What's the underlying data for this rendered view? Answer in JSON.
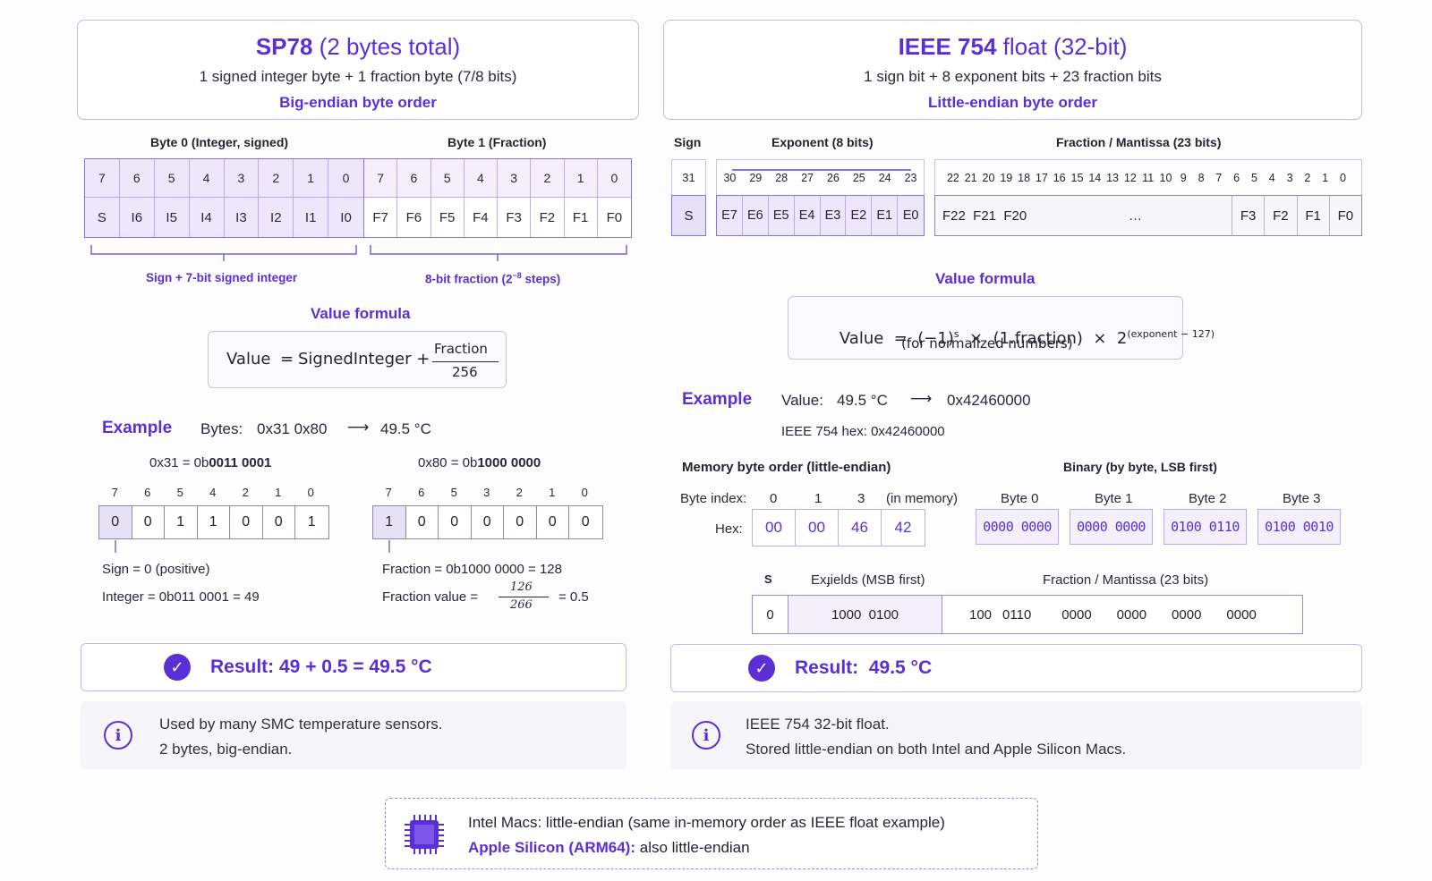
{
  "sp78": {
    "title_bold": "SP78",
    "title_rest": "(2 bytes total)",
    "subtitle": "1 signed integer byte + 1 fraction byte (7/8 bits)",
    "order": "Big-endian byte order",
    "byte0_label": "Byte 0 (Integer, signed)",
    "byte1_label": "Byte 1 (Fraction)",
    "bit_numbers_0": [
      "7",
      "6",
      "5",
      "4",
      "3",
      "2",
      "1",
      "0"
    ],
    "bit_numbers_1": [
      "7",
      "6",
      "5",
      "4",
      "3",
      "2",
      "1",
      "0"
    ],
    "bits_0": [
      "S",
      "I6",
      "I5",
      "I4",
      "I3",
      "I2",
      "I1",
      "I0"
    ],
    "bits_1": [
      "F7",
      "F6",
      "F5",
      "F4",
      "F3",
      "F2",
      "F1",
      "F0"
    ],
    "bracket_0": "Sign + 7-bit signed integer",
    "bracket_1": "8-bit fraction (2",
    "bracket_1_sup": "−8",
    "bracket_1_end": " steps)",
    "formula_title": "Value formula",
    "formula_lhs": "Value",
    "formula_eq": "=",
    "formula_term": "SignedInteger +",
    "formula_num": "Fraction",
    "formula_den": "256",
    "example_title": "Example",
    "example_bytes_label": "Bytes:",
    "example_bytes": "0x31 0x80",
    "example_arrow": "⟶",
    "example_value": "49.5 °C",
    "hex0_label": "0x31 = 0b",
    "hex0_bin": "0011 0001",
    "hex1_label": "0x80 = 0b",
    "hex1_bin": "1000 0000",
    "bits0_nums": [
      "7",
      "6",
      "5",
      "4",
      "2",
      "1",
      "0"
    ],
    "bits0_vals": [
      "0",
      "0",
      "1",
      "1",
      "0",
      "0",
      "1"
    ],
    "bits1_nums": [
      "7",
      "6",
      "5",
      "3",
      "2",
      "1",
      "0"
    ],
    "bits1_vals": [
      "1",
      "0",
      "0",
      "0",
      "0",
      "0",
      "0"
    ],
    "sign_text": "Sign = 0 (positive)",
    "integer_text": "Integer = 0b011 0001 = 49",
    "fraction_text": "Fraction = 0b1000 0000 = 128",
    "fraction_value_label": "Fraction value =",
    "fraction_value_num": "126",
    "fraction_value_den": "266",
    "fraction_value_result": "= 0.5",
    "result": "Result: 49 + 0.5 = 49.5 °C",
    "info_1": "Used by many SMC temperature sensors.",
    "info_2": "2 bytes, big-endian."
  },
  "ieee": {
    "title_bold": "IEEE 754",
    "title_rest": "float (32-bit)",
    "subtitle": "1 sign bit + 8 exponent bits + 23 fraction bits",
    "order": "Little-endian byte order",
    "sign_label": "Sign",
    "exp_label": "Exponent (8 bits)",
    "frac_label": "Fraction / Mantissa (23 bits)",
    "sign_num": "31",
    "exp_nums": [
      "30",
      "29",
      "28",
      "27",
      "26",
      "25",
      "24",
      "23"
    ],
    "frac_nums": [
      "22",
      "21",
      "20",
      "19",
      "18",
      "17",
      "16",
      "15",
      "14",
      "13",
      "12",
      "11",
      "10",
      "9",
      "8",
      "7",
      "6",
      "5",
      "4",
      "3",
      "2",
      "1",
      "0"
    ],
    "sign_bit": "S",
    "exp_bits": [
      "E7",
      "E6",
      "E5",
      "E4",
      "E3",
      "E2",
      "E1",
      "E0"
    ],
    "frac_bits_left": "F22  F21  F20",
    "frac_ellipsis": "…",
    "frac_bits_right": [
      "F3",
      "F2",
      "F1",
      "F0"
    ],
    "formula_title": "Value formula",
    "formula_main": "Value  =  (−1)",
    "formula_s": "s",
    "formula_mid": "  ×  (1.fraction)  ×  2",
    "formula_exp": "(exponent − 127)",
    "formula_note": "(for normalized numbers)",
    "example_title": "Example",
    "example_value_label": "Value:",
    "example_value": "49.5 °C",
    "example_arrow": "⟶",
    "example_hex": "0x42460000",
    "hex_line": "IEEE 754 hex: 0x42460000",
    "mem_title": "Memory byte order (little-endian)",
    "bin_title": "Binary (by byte, LSB first)",
    "byte_index_label": "Byte index:",
    "byte_indices": [
      "0",
      "1",
      "3"
    ],
    "in_memory": "(in memory)",
    "hex_label": "Hex:",
    "hex_values": [
      "00",
      "00",
      "46",
      "42"
    ],
    "bin_labels": [
      "Byte 0",
      "Byte 1",
      "Byte 2",
      "Byte 3"
    ],
    "bin_values": [
      "0000 0000",
      "0000 0000",
      "0100 0110",
      "0100 0010"
    ],
    "mem_s": "S",
    "mem_exp_label": "Exɟields (MSB first)",
    "mem_frac_label": "Fraction / Mantissa (23 bits)",
    "mem_sign_val": "0",
    "mem_exp_val": "1000  0100",
    "mem_frac_vals": [
      "100",
      "0110",
      "0000",
      "0000",
      "0000",
      "0000"
    ],
    "result": "Result:  49.5 °C",
    "info_1": "IEEE 754 32-bit float.",
    "info_2": "Stored little-endian on both Intel and Apple Silicon Macs."
  },
  "footer": {
    "line1": "Intel Macs: little-endian (same in-memory order as IEEE float example)",
    "line2_accent": "Apple Silicon (ARM64):",
    "line2_rest": " also little-endian"
  },
  "icons": {
    "check": "check-icon",
    "info": "info-icon",
    "chip": "cpu-chip-icon"
  },
  "colors": {
    "accent": "#5b2fd6",
    "border": "#c4b8ef",
    "lavender": "#ece7fb"
  }
}
